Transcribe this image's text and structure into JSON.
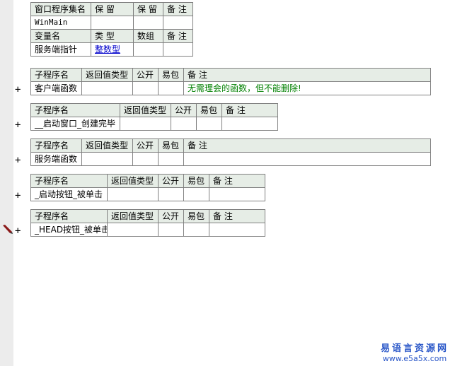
{
  "program_set": {
    "header": [
      "窗口程序集名",
      "保 留",
      "保 留",
      "备 注"
    ],
    "row": [
      "WinMain",
      "",
      "",
      ""
    ],
    "var_header": [
      "变量名",
      "类 型",
      "数组",
      "备 注"
    ],
    "var_row": [
      "服务端指针",
      "整数型",
      "",
      ""
    ]
  },
  "subprograms": [
    {
      "header": [
        "子程序名",
        "返回值类型",
        "公开",
        "易包",
        "备 注"
      ],
      "row": [
        "客户端函数",
        "",
        "",
        "",
        "无需理会的函数，但不能删除!"
      ]
    },
    {
      "header": [
        "子程序名",
        "返回值类型",
        "公开",
        "易包",
        "备 注"
      ],
      "row": [
        "__启动窗口_创建完毕",
        "",
        "",
        "",
        ""
      ]
    },
    {
      "header": [
        "子程序名",
        "返回值类型",
        "公开",
        "易包",
        "备 注"
      ],
      "row": [
        "服务端函数",
        "",
        "",
        "",
        ""
      ]
    },
    {
      "header": [
        "子程序名",
        "返回值类型",
        "公开",
        "易包",
        "备 注"
      ],
      "row": [
        "_启动按钮_被单击",
        "",
        "",
        "",
        ""
      ]
    },
    {
      "header": [
        "子程序名",
        "返回值类型",
        "公开",
        "易包",
        "备 注"
      ],
      "row": [
        "_HEAD按钮_被单击",
        "",
        "",
        "",
        ""
      ]
    }
  ],
  "expand_symbol": "+",
  "icons": {
    "breakpoint": "pen-icon"
  },
  "colors": {
    "header_bg": "#e6ede6",
    "comment": "#008000",
    "type_link": "#0000cc",
    "watermark": "#2a57c8"
  },
  "watermark": {
    "title": "易语言资源网",
    "url": "www.e5a5x.com"
  }
}
